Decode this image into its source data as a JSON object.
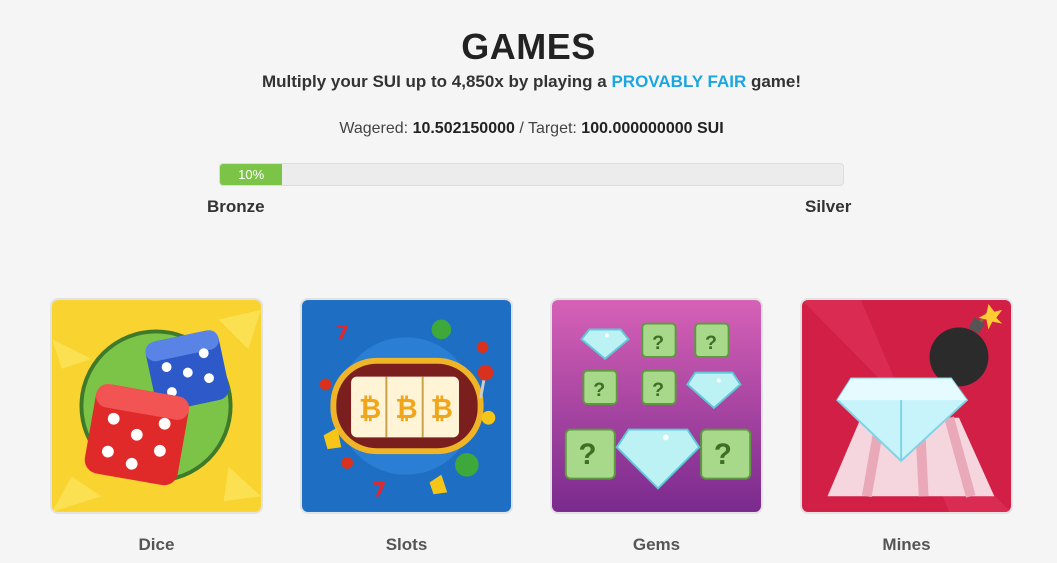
{
  "header": {
    "title": "GAMES",
    "subtitle_prefix": "Multiply your SUI up to 4,850x by playing a ",
    "subtitle_highlight": "PROVABLY FAIR",
    "subtitle_suffix": " game!"
  },
  "wager": {
    "wagered_label": "Wagered: ",
    "wagered_value": "10.502150000",
    "separator": " / Target: ",
    "target_value": "100.000000000 SUI"
  },
  "progress": {
    "percent_label": "10%",
    "fraction": 0.1,
    "from_tier": "Bronze",
    "to_tier": "Silver",
    "fill_color": "#7cc447"
  },
  "games": [
    {
      "label": "Dice",
      "icon": "dice-icon"
    },
    {
      "label": "Slots",
      "icon": "slot-machine-icon"
    },
    {
      "label": "Gems",
      "icon": "gems-icon"
    },
    {
      "label": "Mines",
      "icon": "mines-icon"
    }
  ],
  "colors": {
    "accent": "#1aa6e0",
    "progress": "#7cc447"
  }
}
